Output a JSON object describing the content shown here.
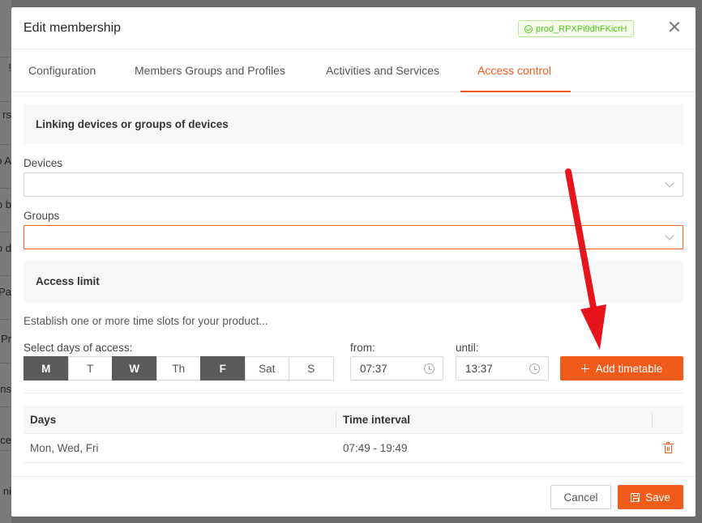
{
  "background_fragments": [
    "!",
    "rs",
    "o A",
    "o b",
    "o d",
    "Pa",
    "Pr",
    "ns",
    "ce",
    "ni"
  ],
  "modal": {
    "title": "Edit membership",
    "product_badge": "prod_RPXPi9dhFKicrH",
    "accent_color": "#f05a1a",
    "badge_color": "#52c41a"
  },
  "tabs": [
    {
      "label": "Configuration",
      "active": false
    },
    {
      "label": "Members Groups and Profiles",
      "active": false
    },
    {
      "label": "Activities and Services",
      "active": false
    },
    {
      "label": "Access control",
      "active": true
    }
  ],
  "linking": {
    "title": "Linking devices or groups of devices",
    "devices_label": "Devices",
    "devices_value": "",
    "groups_label": "Groups",
    "groups_value": ""
  },
  "access_limit": {
    "title": "Access limit",
    "hint": "Establish one or more time slots for your product...",
    "days_label": "Select days of access:",
    "days": [
      {
        "label": "M",
        "selected": true
      },
      {
        "label": "T",
        "selected": false
      },
      {
        "label": "W",
        "selected": true
      },
      {
        "label": "Th",
        "selected": false
      },
      {
        "label": "F",
        "selected": true
      },
      {
        "label": "Sat",
        "selected": false
      },
      {
        "label": "S",
        "selected": false
      }
    ],
    "from_label": "from:",
    "from_value": "07:37",
    "until_label": "until:",
    "until_value": "13:37",
    "add_button": "Add timetable"
  },
  "table": {
    "headers": [
      "Days",
      "Time interval"
    ],
    "rows": [
      {
        "days": "Mon, Wed, Fri",
        "interval": "07:49 - 19:49"
      }
    ]
  },
  "footer": {
    "cancel": "Cancel",
    "save": "Save"
  },
  "annotation_color": "#e8141c"
}
